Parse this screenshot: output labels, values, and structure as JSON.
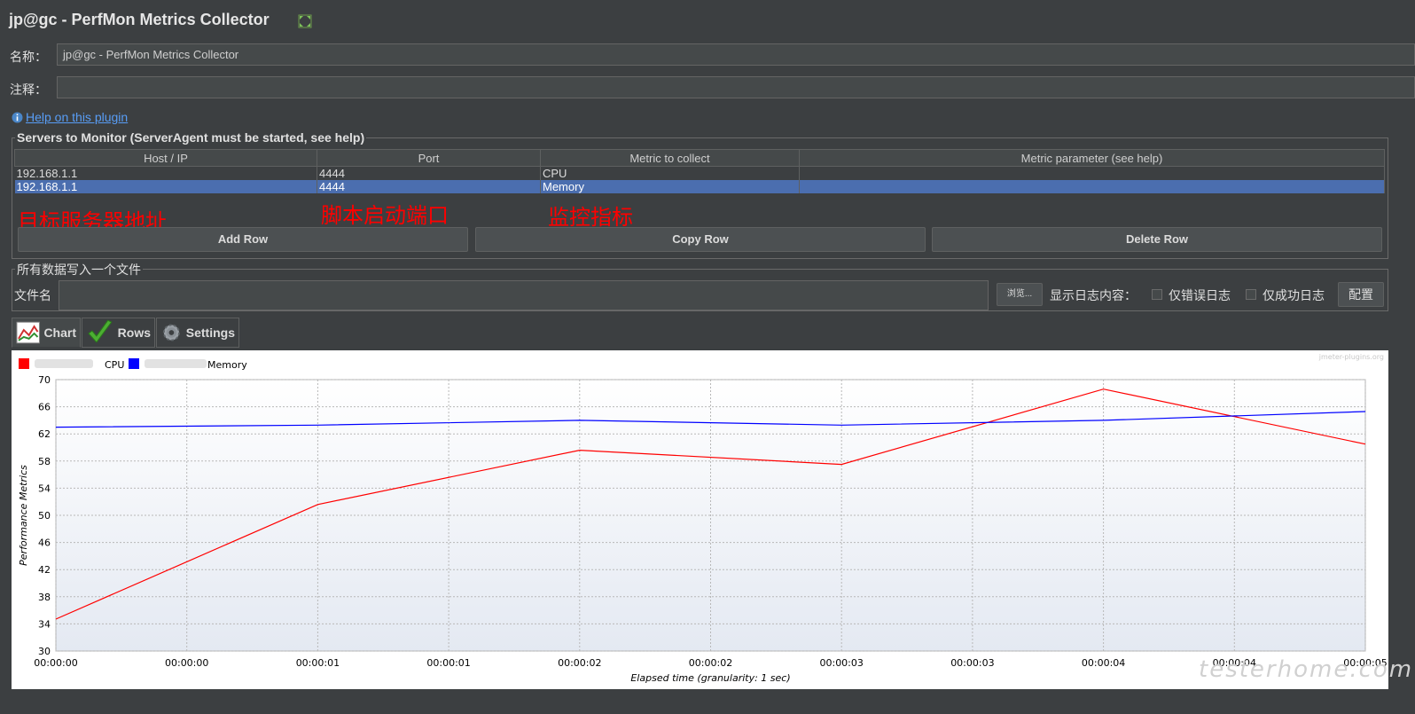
{
  "header": {
    "title": "jp@gc - PerfMon Metrics Collector"
  },
  "form": {
    "name_label": "名称：",
    "name_value": "jp@gc - PerfMon Metrics Collector",
    "comment_label": "注释：",
    "comment_value": "",
    "help_link": "Help on this plugin"
  },
  "servers": {
    "group_title": "Servers to Monitor (ServerAgent must be started, see help)",
    "columns": [
      "Host / IP",
      "Port",
      "Metric to collect",
      "Metric parameter (see help)"
    ],
    "rows": [
      {
        "host": "192.168.1.1",
        "port": "4444",
        "metric": "CPU",
        "param": "",
        "selected": false
      },
      {
        "host": "192.168.1.1",
        "port": "4444",
        "metric": "Memory",
        "param": "",
        "selected": true
      }
    ],
    "annotations": [
      "目标服务器地址",
      "脚本启动端口",
      "监控指标"
    ],
    "add_row": "Add Row",
    "copy_row": "Copy Row",
    "delete_row": "Delete Row"
  },
  "file": {
    "group_title": "所有数据写入一个文件",
    "filename_label": "文件名",
    "filename_value": "",
    "browse_button": "浏览...",
    "log_label": "显示日志内容：",
    "errors_only_label": "仅错误日志",
    "errors_only_checked": false,
    "success_only_label": "仅成功日志",
    "success_only_checked": false,
    "config_button": "配置"
  },
  "tabs": [
    {
      "label": "Chart",
      "icon": "chart-icon",
      "active": true
    },
    {
      "label": "Rows",
      "icon": "checkmark-icon",
      "active": false
    },
    {
      "label": "Settings",
      "icon": "gear-icon",
      "active": false
    }
  ],
  "chart_data": {
    "type": "line",
    "xlabel": "Elapsed time (granularity: 1 sec)",
    "ylabel": "Performance Metrics",
    "ylim": [
      30,
      70
    ],
    "yticks": [
      30,
      34,
      38,
      42,
      46,
      50,
      54,
      58,
      62,
      66,
      70
    ],
    "x_tick_labels": [
      "00:00:00",
      "00:00:00",
      "00:00:01",
      "00:00:01",
      "00:00:02",
      "00:00:02",
      "00:00:03",
      "00:00:03",
      "00:00:04",
      "00:00:04",
      "00:00:05"
    ],
    "x_points": [
      0,
      2,
      4,
      6,
      8,
      10
    ],
    "grid": true,
    "legend_position": "top-left",
    "watermark": "jmeter-plugins.org",
    "series": [
      {
        "name": "CPU",
        "color": "#ff0000",
        "values": [
          34.7,
          51.6,
          59.6,
          57.5,
          68.6,
          60.5
        ]
      },
      {
        "name": "Memory",
        "color": "#0000ff",
        "values": [
          63.0,
          63.3,
          64.0,
          63.3,
          64.0,
          65.3
        ]
      }
    ]
  },
  "site_watermark": "testerhome.com"
}
